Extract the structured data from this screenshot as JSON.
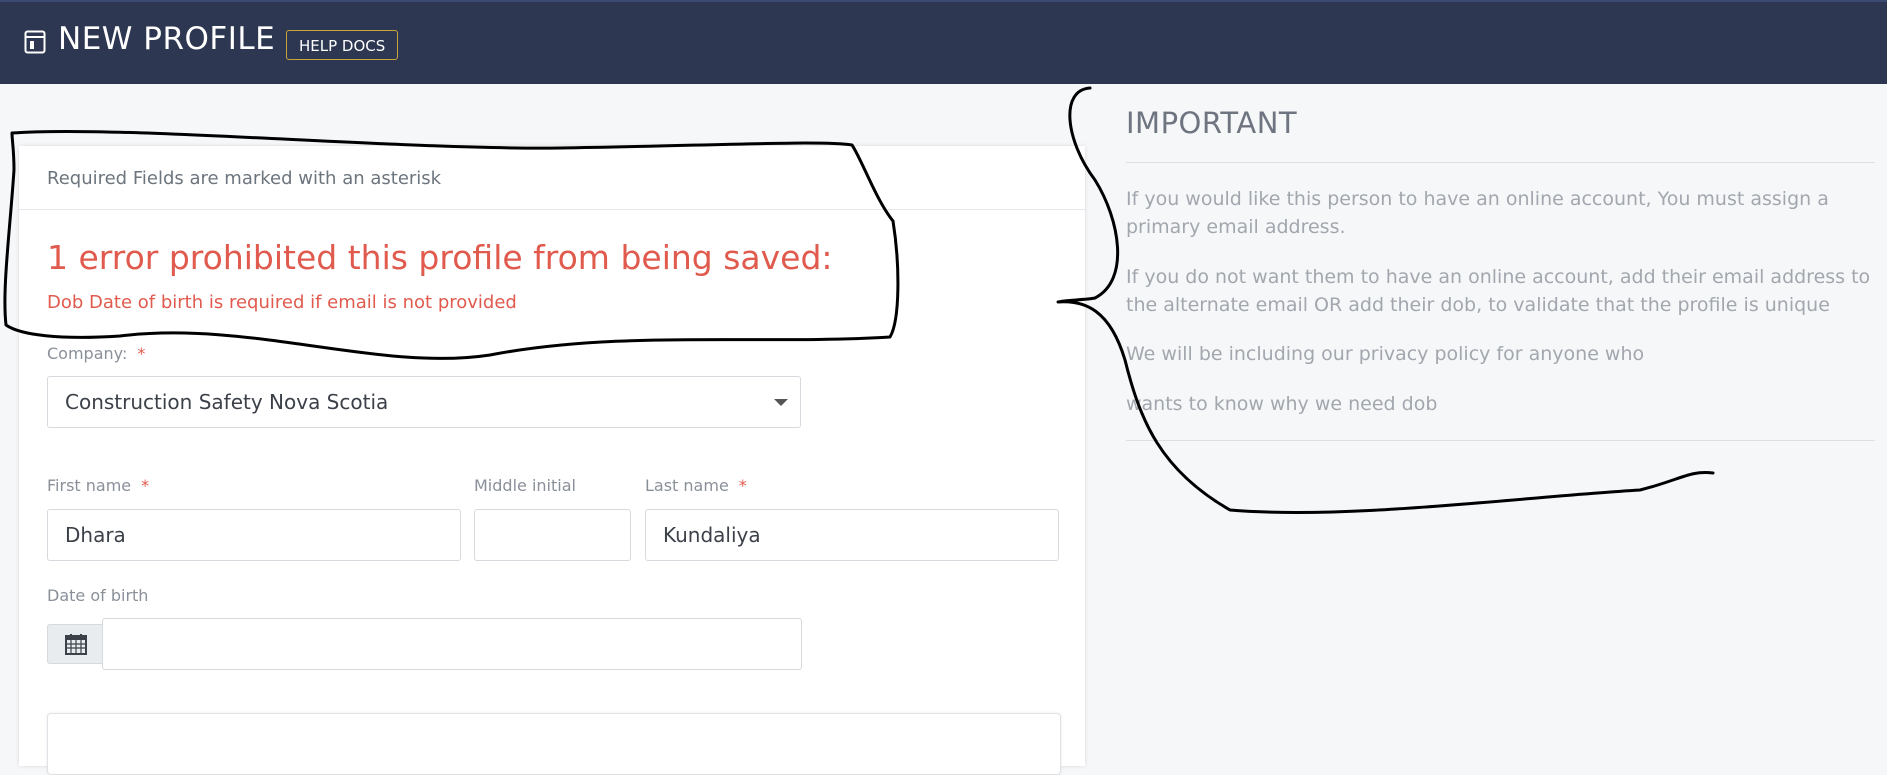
{
  "header": {
    "title": "NEW PROFILE",
    "help_label": "HELP DOCS",
    "background_color": "#2d3751"
  },
  "form": {
    "required_note": "Required Fields are marked with an asterisk",
    "error_title": "1 error prohibited this profile from being saved:",
    "error_message": "Dob Date of birth is required if email is not provided",
    "error_color": "#e05a4e",
    "company": {
      "label": "Company:",
      "required_mark": "*",
      "value": "Construction Safety Nova Scotia"
    },
    "first_name": {
      "label": "First name",
      "required_mark": "*",
      "value": "Dhara"
    },
    "middle_initial": {
      "label": "Middle initial",
      "value": ""
    },
    "last_name": {
      "label": "Last name",
      "required_mark": "*",
      "value": "Kundaliya"
    },
    "date_of_birth": {
      "label": "Date of birth",
      "value": "",
      "icon": "calendar-icon"
    }
  },
  "sidebar": {
    "heading": "IMPORTANT",
    "paragraphs": [
      "If you would like this person to have an online account, You must assign a primary email address.",
      "If you do not want them to have an online account, add their email address to the alternate email OR add their dob, to validate that the profile is unique",
      "We will be including our privacy policy for anyone who",
      "wants to know why we need dob"
    ]
  }
}
